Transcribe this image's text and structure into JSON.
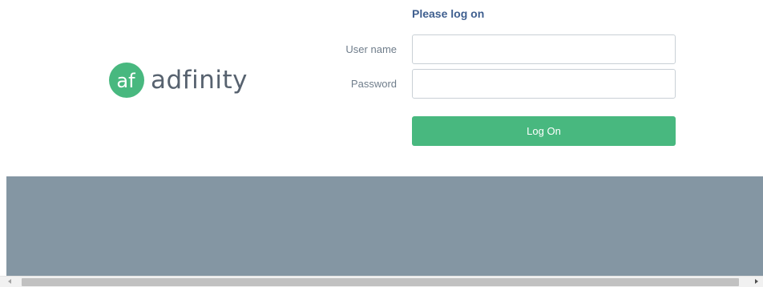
{
  "brand": {
    "name": "adfinity",
    "mark_glyph": "af",
    "color": "#48b87f"
  },
  "login": {
    "title": "Please log on",
    "username_label": "User name",
    "username_value": "",
    "password_label": "Password",
    "password_value": "",
    "submit_label": "Log On"
  },
  "colors": {
    "button": "#48b87f",
    "title": "#3f5f8f",
    "footer_band": "#8496a3"
  }
}
